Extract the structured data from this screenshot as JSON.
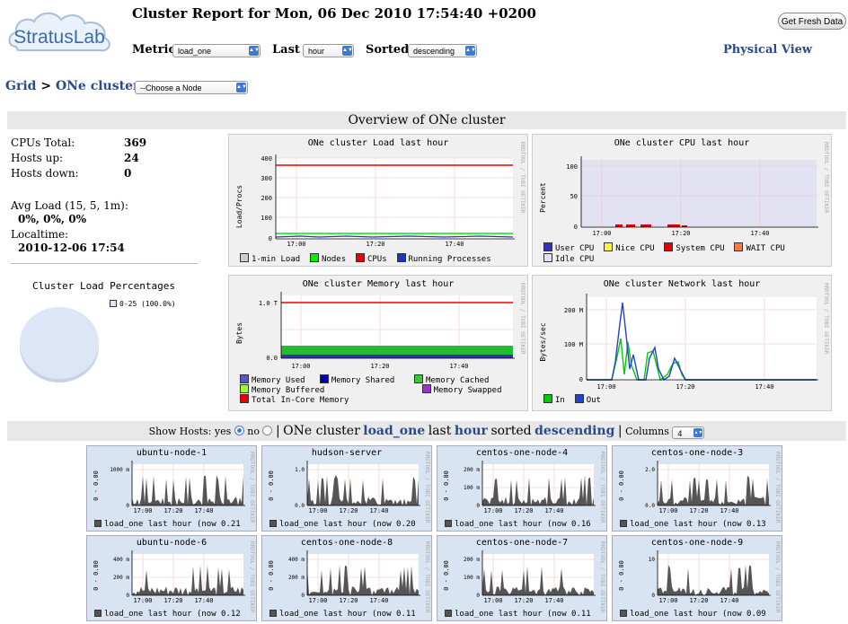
{
  "header": {
    "logo_text": "StratusLab",
    "report_title": "Cluster Report for Mon, 06 Dec 2010 17:54:40 +0200",
    "fresh_button": "Get Fresh Data",
    "metric_label": "Metric",
    "metric_value": "load_one",
    "last_label": "Last",
    "last_value": "hour",
    "sorted_label": "Sorted",
    "sorted_value": "descending",
    "physical_view": "Physical View"
  },
  "breadcrumb": {
    "grid": "Grid",
    "sep1": ">",
    "cluster": "ONe cluster",
    "sep2": ">",
    "node_select": "--Choose a Node"
  },
  "overview": {
    "title": "Overview of ONe cluster",
    "cpus_total_label": "CPUs Total:",
    "cpus_total": "369",
    "hosts_up_label": "Hosts up:",
    "hosts_up": "24",
    "hosts_down_label": "Hosts down:",
    "hosts_down": "0",
    "avg_load_label": "Avg Load (15, 5, 1m):",
    "avg_load": "0%, 0%, 0%",
    "localtime_label": "Localtime:",
    "localtime": "2010-12-06 17:54",
    "cluster_load_title": "Cluster Load Percentages",
    "cluster_load_legend": "0-25 (100.0%)"
  },
  "graphs": {
    "load": {
      "title": "ONe cluster Load last hour",
      "ylabel": "Load/Procs",
      "yticks": [
        "400",
        "300",
        "200",
        "100",
        "0"
      ],
      "xticks": [
        "17:00",
        "17:20",
        "17:40"
      ],
      "legend": [
        "1-min Load",
        "Nodes",
        "CPUs",
        "Running Processes"
      ],
      "colors": [
        "#cccccc",
        "#00ee00",
        "#ee0000",
        "#2233cc"
      ]
    },
    "cpu": {
      "title": "ONe cluster CPU last hour",
      "ylabel": "Percent",
      "yticks": [
        "100",
        "50",
        "0"
      ],
      "xticks": [
        "17:00",
        "17:20",
        "17:40"
      ],
      "legend": [
        "User CPU",
        "Nice CPU",
        "System CPU",
        "WAIT CPU",
        "Idle CPU"
      ],
      "colors": [
        "#3333bb",
        "#ffee44",
        "#dd0000",
        "#ff7744",
        "#e2e2f2"
      ]
    },
    "memory": {
      "title": "ONe cluster Memory last hour",
      "ylabel": "Bytes",
      "yticks": [
        "1.0 T",
        "0.0"
      ],
      "xticks": [
        "17:00",
        "17:20",
        "17:40"
      ],
      "legend": [
        "Memory Used",
        "Memory Shared",
        "Memory Cached",
        "Memory Buffered",
        "Memory Swapped",
        "Total In-Core Memory"
      ],
      "colors": [
        "#5555cc",
        "#0000aa",
        "#33cc33",
        "#99ff33",
        "#9933cc",
        "#ee0000"
      ]
    },
    "network": {
      "title": "ONe cluster Network last hour",
      "ylabel": "Bytes/sec",
      "yticks": [
        "200 M",
        "100 M",
        "0"
      ],
      "xticks": [
        "17:00",
        "17:20",
        "17:40"
      ],
      "legend": [
        "In",
        "Out"
      ],
      "colors": [
        "#00cc00",
        "#2244cc"
      ]
    },
    "side_tag": "RRDTOOL / TOBI OETIKER"
  },
  "hosts_bar": {
    "show_hosts": "Show Hosts: yes",
    "no": "no",
    "sep": "|",
    "cluster": "ONe cluster",
    "metric": "load_one",
    "last": "last",
    "hour": "hour",
    "sorted": "sorted",
    "descending": "descending",
    "sep2": "|",
    "columns_label": "Columns",
    "columns_value": "4"
  },
  "nodes": [
    {
      "name": "ubuntu-node-1",
      "yticks": [
        "1000 m",
        "0"
      ],
      "now": "load_one last hour (now 0.21"
    },
    {
      "name": "hudson-server",
      "yticks": [
        "1.0",
        "0.0"
      ],
      "now": "load_one last hour (now 0.20"
    },
    {
      "name": "centos-one-node-4",
      "yticks": [
        "200 m",
        "100 m",
        "0"
      ],
      "now": "load_one last hour (now 0.16"
    },
    {
      "name": "centos-one-node-3",
      "yticks": [
        "2.0",
        "0.0"
      ],
      "now": "load_one last hour (now 0.13"
    },
    {
      "name": "ubuntu-node-6",
      "yticks": [
        "400 m",
        "200 m",
        "0"
      ],
      "now": "load_one last hour (now 0.12"
    },
    {
      "name": "centos-one-node-8",
      "yticks": [
        "400 m",
        "200 m",
        "0"
      ],
      "now": "load_one last hour (now 0.11"
    },
    {
      "name": "centos-one-node-7",
      "yticks": [
        "200 m",
        "100 m",
        "0"
      ],
      "now": "load_one last hour (now 0.11"
    },
    {
      "name": "centos-one-node-9",
      "yticks": [
        "10",
        "0"
      ],
      "now": "load_one last hour (now 0.09"
    }
  ],
  "node_xticks": [
    "17:00",
    "17:20",
    "17:40"
  ],
  "node_ylabel": "0 - 0.00"
}
